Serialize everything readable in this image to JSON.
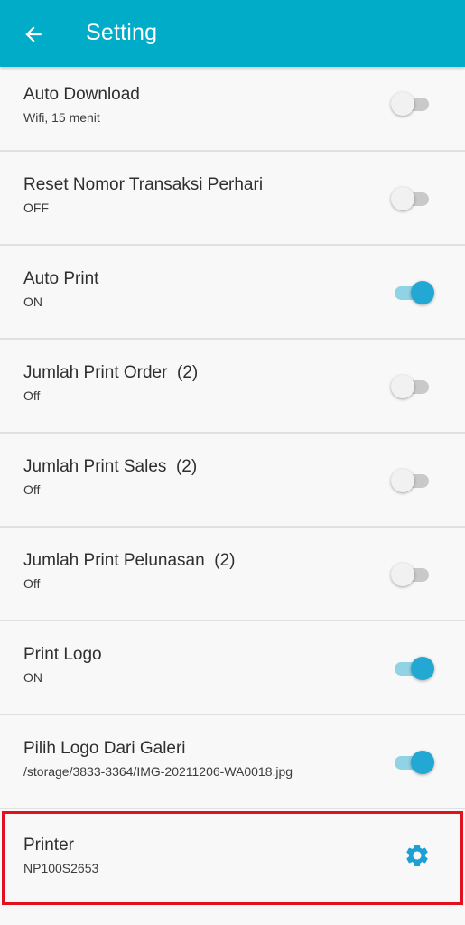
{
  "appbar": {
    "title": "Setting",
    "color": "#00acc8"
  },
  "settings": [
    {
      "title": "Auto Download",
      "subtitle": "Wifi, 15 menit",
      "enabled": false
    },
    {
      "title": "Reset Nomor Transaksi Perhari",
      "subtitle": "OFF",
      "enabled": false
    },
    {
      "title": "Auto Print",
      "subtitle": "ON",
      "enabled": true
    },
    {
      "title": "Jumlah Print Order  (2)",
      "subtitle": "Off",
      "enabled": false
    },
    {
      "title": "Jumlah Print Sales  (2)",
      "subtitle": "Off",
      "enabled": false
    },
    {
      "title": "Jumlah Print Pelunasan  (2)",
      "subtitle": "Off",
      "enabled": false
    },
    {
      "title": "Print Logo",
      "subtitle": "ON",
      "enabled": true
    },
    {
      "title": "Pilih Logo Dari Galeri",
      "subtitle": "/storage/3833-3364/IMG-20211206-WA0018.jpg",
      "enabled": true
    }
  ],
  "printer": {
    "title": "Printer",
    "subtitle": "NP100S2653",
    "icon": "gear-icon",
    "highlight_color": "#e2111e"
  },
  "colors": {
    "switch_on": "#23a8d4",
    "accent_icon": "#1da1d2"
  }
}
